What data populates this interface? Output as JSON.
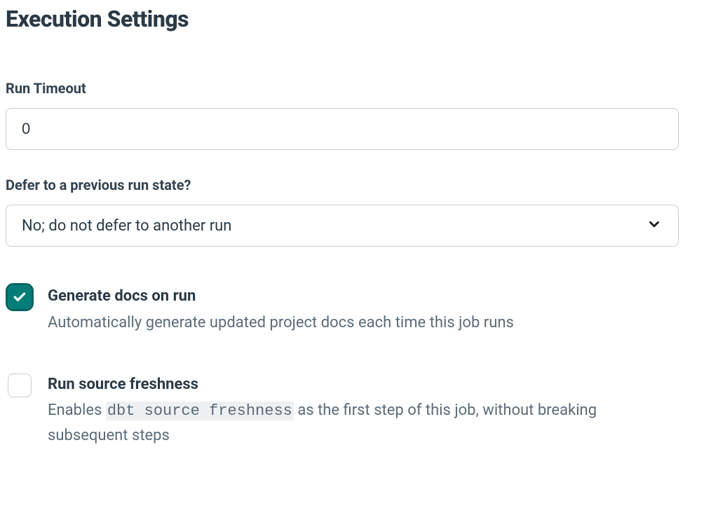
{
  "section": {
    "title": "Execution Settings"
  },
  "runTimeout": {
    "label": "Run Timeout",
    "value": "0"
  },
  "deferRun": {
    "label": "Defer to a previous run state?",
    "selected": "No; do not defer to another run"
  },
  "generateDocs": {
    "checked": true,
    "title": "Generate docs on run",
    "description": "Automatically generate updated project docs each time this job runs"
  },
  "sourceFreshness": {
    "checked": false,
    "title": "Run source freshness",
    "desc_before": "Enables ",
    "code": "dbt source freshness",
    "desc_after": " as the first step of this job, without breaking subsequent steps"
  }
}
